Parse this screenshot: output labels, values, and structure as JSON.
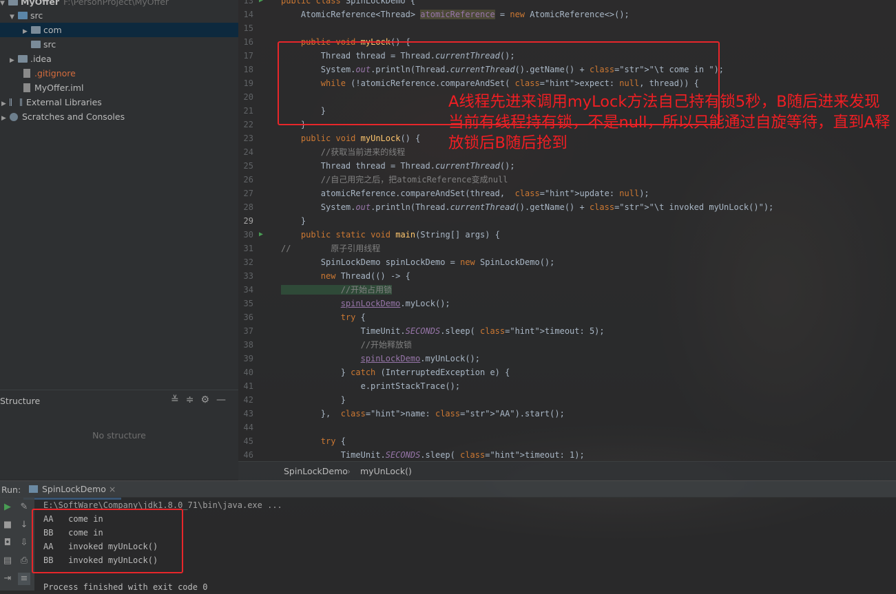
{
  "project_tree": {
    "items": [
      {
        "label": "MyOffer",
        "path": "F:\\PersonProject\\MyOffer"
      },
      {
        "label": "src"
      },
      {
        "label": "com"
      },
      {
        "label": "src"
      },
      {
        "label": ".idea"
      },
      {
        "label": ".gitignore"
      },
      {
        "label": "MyOffer.iml"
      },
      {
        "label": "External Libraries"
      },
      {
        "label": "Scratches and Consoles"
      }
    ]
  },
  "structure": {
    "title": "Structure",
    "empty_text": "No structure"
  },
  "editor": {
    "lines": [
      {
        "n": "13",
        "t": "public class SpinLockDemo {"
      },
      {
        "n": "14",
        "t": "    AtomicReference<Thread> atomicReference = new AtomicReference<>();"
      },
      {
        "n": "15",
        "t": ""
      },
      {
        "n": "16",
        "t": "    public void myLock() {"
      },
      {
        "n": "17",
        "t": "        Thread thread = Thread.currentThread();"
      },
      {
        "n": "18",
        "t": "        System.out.println(Thread.currentThread().getName() + \"\\t come in \");"
      },
      {
        "n": "19",
        "t": "        while (!atomicReference.compareAndSet( expect: null, thread)) {"
      },
      {
        "n": "20",
        "t": ""
      },
      {
        "n": "21",
        "t": "        }"
      },
      {
        "n": "22",
        "t": "    }"
      },
      {
        "n": "23",
        "t": "    public void myUnLock() {"
      },
      {
        "n": "24",
        "t": "        //获取当前进来的线程"
      },
      {
        "n": "25",
        "t": "        Thread thread = Thread.currentThread();"
      },
      {
        "n": "26",
        "t": "        //自己用完之后，把atomicReference变成null"
      },
      {
        "n": "27",
        "t": "        atomicReference.compareAndSet(thread,  update: null);"
      },
      {
        "n": "28",
        "t": "        System.out.println(Thread.currentThread().getName() + \"\\t invoked myUnLock()\");"
      },
      {
        "n": "29",
        "t": "    }"
      },
      {
        "n": "30",
        "t": "    public static void main(String[] args) {"
      },
      {
        "n": "31",
        "t": "//        原子引用线程"
      },
      {
        "n": "32",
        "t": "        SpinLockDemo spinLockDemo = new SpinLockDemo();"
      },
      {
        "n": "33",
        "t": "        new Thread(() -> {"
      },
      {
        "n": "34",
        "t": "            //开始占用锁"
      },
      {
        "n": "35",
        "t": "            spinLockDemo.myLock();"
      },
      {
        "n": "36",
        "t": "            try {"
      },
      {
        "n": "37",
        "t": "                TimeUnit.SECONDS.sleep( timeout: 5);"
      },
      {
        "n": "38",
        "t": "                //开始释放锁"
      },
      {
        "n": "39",
        "t": "                spinLockDemo.myUnLock();"
      },
      {
        "n": "40",
        "t": "            } catch (InterruptedException e) {"
      },
      {
        "n": "41",
        "t": "                e.printStackTrace();"
      },
      {
        "n": "42",
        "t": "            }"
      },
      {
        "n": "43",
        "t": "        },  name: \"AA\").start();"
      },
      {
        "n": "44",
        "t": ""
      },
      {
        "n": "45",
        "t": "        try {"
      },
      {
        "n": "46",
        "t": "            TimeUnit.SECONDS.sleep( timeout: 1);"
      }
    ]
  },
  "breadcrumb": {
    "class_name": "SpinLockDemo",
    "method_name": "myUnLock()"
  },
  "run": {
    "label": "Run:",
    "tab_label": "SpinLockDemo",
    "command": "E:\\SoftWare\\Company\\jdk1.8.0_71\\bin\\java.exe ...",
    "output": [
      "AA   come in",
      "BB   come in",
      "AA   invoked myUnLock()",
      "BB   invoked myUnLock()"
    ],
    "exit_text": "Process finished with exit code 0"
  },
  "annotation": {
    "text": "A线程先进来调用myLock方法自己持有锁5秒，B随后进来发现当前有线程持有锁，不是null，所以只能通过自旋等待，直到A释放锁后B随后抢到",
    "color": "#f01e23"
  }
}
